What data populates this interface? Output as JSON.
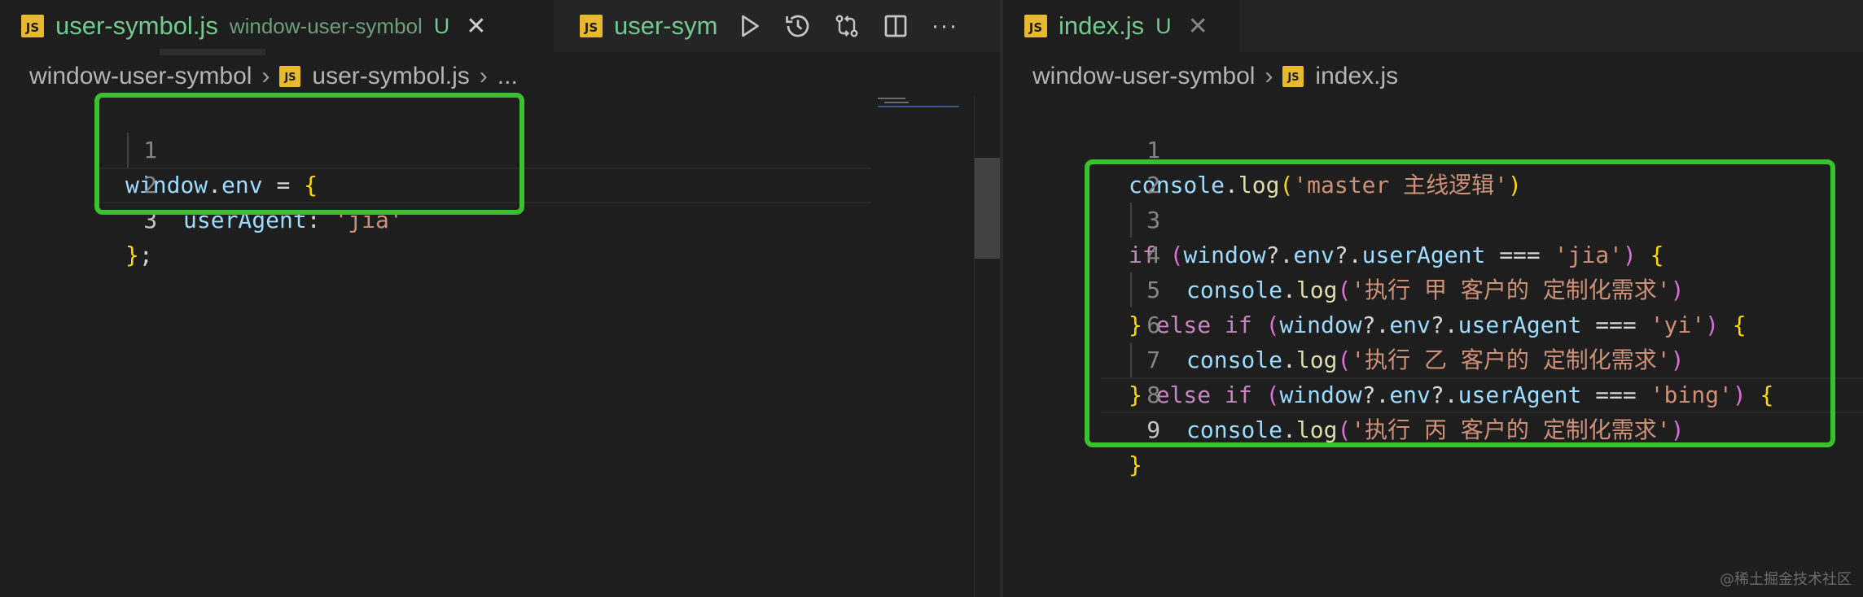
{
  "left_pane": {
    "tabs": [
      {
        "icon": "JS",
        "name": "user-symbol.js",
        "description": "window-user-symbol",
        "status": "U",
        "close": "✕"
      },
      {
        "icon": "JS",
        "name": "user-sym"
      }
    ],
    "breadcrumb": [
      "window-user-symbol",
      "user-symbol.js",
      "..."
    ],
    "line_numbers": [
      "1",
      "2",
      "3"
    ],
    "code": {
      "l1": {
        "obj": "window",
        "dot": ".",
        "prop": "env",
        "eq": " = ",
        "brace": "{"
      },
      "l2": {
        "key": "userAgent",
        "colon": ": ",
        "value": "'jia'"
      },
      "l3": {
        "brace": "}",
        "semi": ";"
      }
    }
  },
  "right_pane": {
    "tab": {
      "icon": "JS",
      "name": "index.js",
      "status": "U",
      "close": "✕"
    },
    "breadcrumb": [
      "window-user-symbol",
      "index.js"
    ],
    "line_numbers": [
      "1",
      "2",
      "3",
      "4",
      "5",
      "6",
      "7",
      "8",
      "9"
    ],
    "code": {
      "l1": {
        "obj": "console",
        "fn": "log",
        "arg": "'master 主线逻辑'"
      },
      "l3": {
        "kw": "if",
        "cond_obj": "window",
        "cond_prop1": "env",
        "cond_prop2": "userAgent",
        "op": "===",
        "value": "'jia'"
      },
      "l4": {
        "obj": "console",
        "fn": "log",
        "arg": "'执行 甲 客户的 定制化需求'"
      },
      "l5": {
        "kw1": "else",
        "kw2": "if",
        "cond_obj": "window",
        "cond_prop1": "env",
        "cond_prop2": "userAgent",
        "op": "===",
        "value": "'yi'"
      },
      "l6": {
        "obj": "console",
        "fn": "log",
        "arg": "'执行 乙 客户的 定制化需求'"
      },
      "l7": {
        "kw1": "else",
        "kw2": "if",
        "cond_obj": "window",
        "cond_prop1": "env",
        "cond_prop2": "userAgent",
        "op": "===",
        "value": "'bing'"
      },
      "l8": {
        "obj": "console",
        "fn": "log",
        "arg": "'执行 丙 客户的 定制化需求'"
      },
      "l9": {
        "brace": "}"
      }
    }
  },
  "editor_actions": [
    "run-icon",
    "timeline-icon",
    "compare-changes-icon",
    "split-editor-icon",
    "more-actions-icon"
  ],
  "more_label": "···",
  "highlight_color": "#3ac12d",
  "watermark": "@稀土掘金技术社区"
}
